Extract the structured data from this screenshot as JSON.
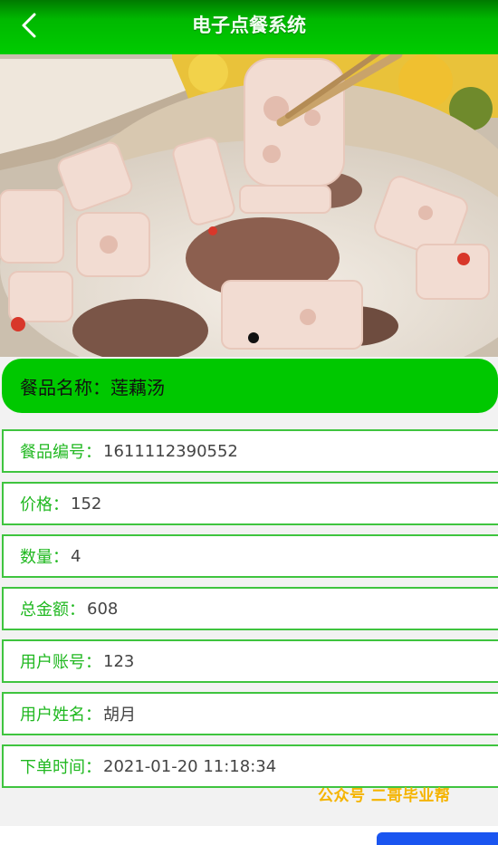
{
  "header": {
    "title": "电子点餐系统"
  },
  "dish": {
    "name_label": "餐品名称：",
    "name_value": "莲藕汤"
  },
  "details": [
    {
      "label": "餐品编号：",
      "value": "1611112390552"
    },
    {
      "label": "价格：",
      "value": "152"
    },
    {
      "label": "数量：",
      "value": "4"
    },
    {
      "label": "总金额：",
      "value": "608"
    },
    {
      "label": "用户账号：",
      "value": "123"
    },
    {
      "label": "用户姓名：",
      "value": "胡月"
    },
    {
      "label": "下单时间：",
      "value": "2021-01-20 11:18:34"
    }
  ],
  "watermark": "公众号 二哥毕业帮",
  "colors": {
    "accent_green": "#00c800",
    "border_green": "#3fc43f",
    "label_green": "#20b820",
    "bottom_button_blue": "#1a55f0",
    "watermark_yellow": "#f5b400"
  },
  "icons": {
    "back": "chevron-left-icon"
  }
}
